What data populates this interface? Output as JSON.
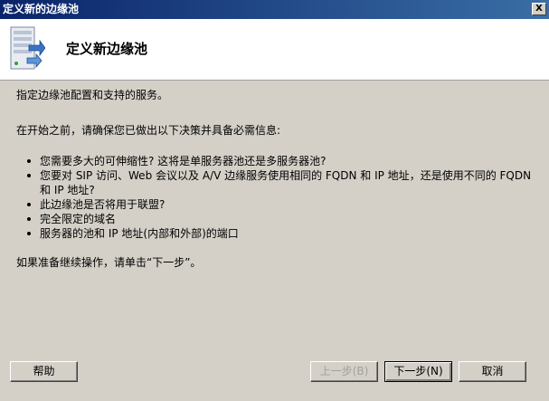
{
  "window": {
    "title": "定义新的边缘池",
    "close_label": "X"
  },
  "header": {
    "title": "定义新边缘池",
    "icon": "server-network-icon"
  },
  "content": {
    "intro": "指定边缘池配置和支持的服务。",
    "before_start": "在开始之前，请确保您已做出以下决策并具备必需信息:",
    "bullets": [
      "您需要多大的可伸缩性? 这将是单服务器池还是多服务器池?",
      "您要对 SIP 访问、Web 会议以及 A/V 边缘服务使用相同的 FQDN 和 IP 地址，还是使用不同的 FQDN 和 IP 地址?",
      "此边缘池是否将用于联盟?",
      "完全限定的域名",
      "服务器的池和 IP 地址(内部和外部)的端口"
    ],
    "footer": "如果准备继续操作，请单击“下一步”。"
  },
  "buttons": {
    "help": "帮助",
    "back": "上一步(B)",
    "next": "下一步(N)",
    "cancel": "取消"
  }
}
